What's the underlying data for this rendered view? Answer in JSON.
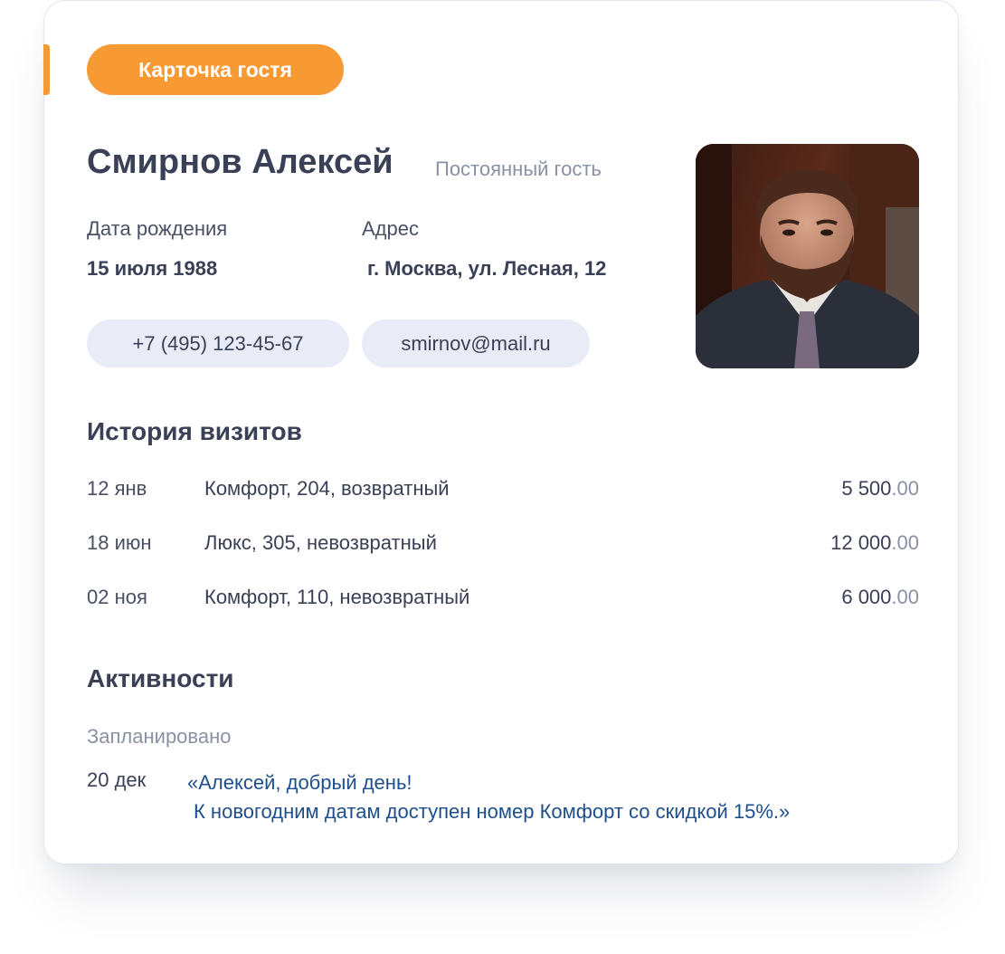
{
  "card": {
    "badge_label": "Карточка гостя",
    "accent_color": "#f79a34"
  },
  "guest": {
    "name": "Смирнов Алексей",
    "status": "Постоянный гость",
    "birth_label": "Дата рождения",
    "birth_value": "15 июля 1988",
    "address_label": "Адрес",
    "address_value": "г. Москва, ул. Лесная, 12",
    "phone": "+7 (495) 123-45-67",
    "email": "smirnov@mail.ru",
    "photo_icon": "guest-photo"
  },
  "visits": {
    "title": "История визитов",
    "rows": [
      {
        "date": "12 янв",
        "description": "Комфорт, 204, возвратный",
        "amount_main": "5 500",
        "amount_cents": ".00"
      },
      {
        "date": "18 июн",
        "description": "Люкс, 305, невозвратный",
        "amount_main": "12 000",
        "amount_cents": ".00"
      },
      {
        "date": "02 ноя",
        "description": "Комфорт, 110, невозвратный",
        "amount_main": "6 000",
        "amount_cents": ".00"
      }
    ]
  },
  "activities": {
    "title": "Активности",
    "planned_label": "Запланировано",
    "item": {
      "date": "20 дек",
      "message_line1": "«Алексей, добрый день!",
      "message_line2": "К новогодним датам доступен номер Комфорт со скидкой 15%.»",
      "message_color": "#1e4f8c"
    }
  }
}
